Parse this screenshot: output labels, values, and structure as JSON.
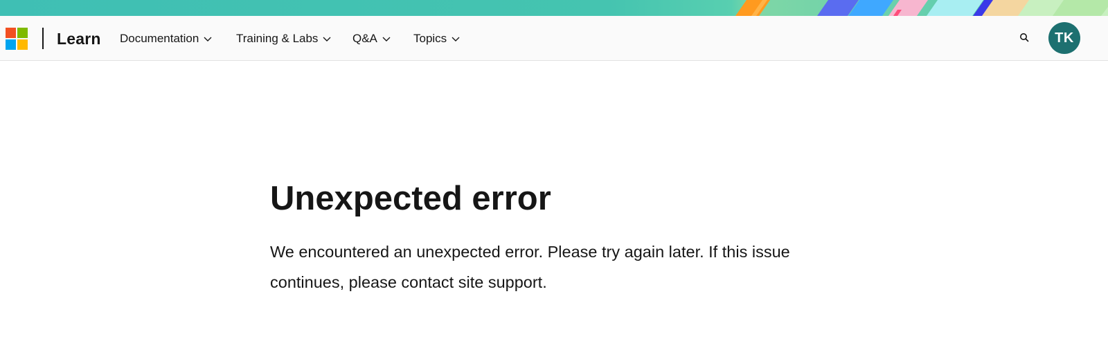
{
  "banner": {
    "colors": [
      "#45c4b0",
      "#ff9a1f",
      "#4b6bff",
      "#f6a8c8",
      "#8de8f0",
      "#3a3ae8"
    ]
  },
  "header": {
    "logo_icon": "microsoft-logo-icon",
    "brand": "Learn",
    "nav": [
      {
        "label": "Documentation",
        "icon": "chevron-down-icon"
      },
      {
        "label": "Training & Labs",
        "icon": "chevron-down-icon"
      },
      {
        "label": "Q&A",
        "icon": "chevron-down-icon"
      },
      {
        "label": "Topics",
        "icon": "chevron-down-icon"
      }
    ],
    "search_icon": "search-icon",
    "avatar_initials": "TK",
    "avatar_color": "#1d7070"
  },
  "main": {
    "title": "Unexpected error",
    "message": "We encountered an unexpected error. Please try again later. If this issue continues, please contact site support."
  }
}
